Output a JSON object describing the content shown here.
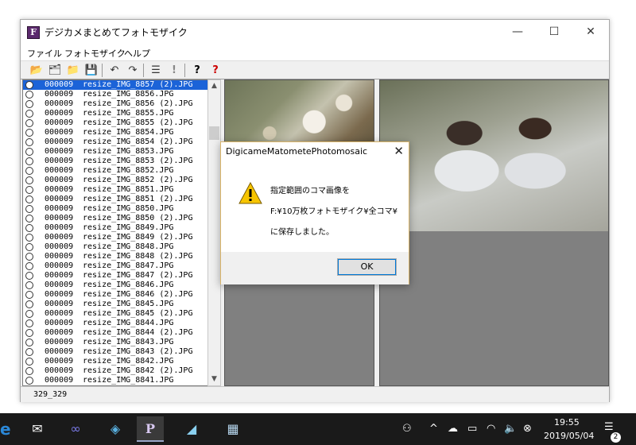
{
  "window": {
    "title": "デジカメまとめてフォトモザイク",
    "icon_letter": "F",
    "minimize": "—",
    "maximize": "☐",
    "close": "✕"
  },
  "menu": [
    "ファイル",
    "フォトモザイク",
    "ヘルプ"
  ],
  "toolbar": {
    "icons": [
      "open-folder-icon",
      "new-folder-icon",
      "folder-icon",
      "save-icon",
      "undo-icon",
      "redo-icon",
      "list-icon",
      "exclamation-icon",
      "help-icon",
      "help-red-icon"
    ],
    "glyphs": [
      "📂",
      "🗂",
      "📁",
      "💾",
      "↶",
      "↷",
      "☰",
      "!",
      "?",
      "?"
    ],
    "help_red_color": "#cc0000"
  },
  "file_list": {
    "rows": [
      {
        "num": "000009",
        "name": "resize_IMG_8857 (2).JPG"
      },
      {
        "num": "000009",
        "name": "resize_IMG_8856.JPG"
      },
      {
        "num": "000009",
        "name": "resize_IMG_8856 (2).JPG"
      },
      {
        "num": "000009",
        "name": "resize_IMG_8855.JPG"
      },
      {
        "num": "000009",
        "name": "resize_IMG_8855 (2).JPG"
      },
      {
        "num": "000009",
        "name": "resize_IMG_8854.JPG"
      },
      {
        "num": "000009",
        "name": "resize_IMG_8854 (2).JPG"
      },
      {
        "num": "000009",
        "name": "resize_IMG_8853.JPG"
      },
      {
        "num": "000009",
        "name": "resize_IMG_8853 (2).JPG"
      },
      {
        "num": "000009",
        "name": "resize_IMG_8852.JPG"
      },
      {
        "num": "000009",
        "name": "resize_IMG_8852 (2).JPG"
      },
      {
        "num": "000009",
        "name": "resize_IMG_8851.JPG"
      },
      {
        "num": "000009",
        "name": "resize_IMG_8851 (2).JPG"
      },
      {
        "num": "000009",
        "name": "resize_IMG_8850.JPG"
      },
      {
        "num": "000009",
        "name": "resize_IMG_8850 (2).JPG"
      },
      {
        "num": "000009",
        "name": "resize_IMG_8849.JPG"
      },
      {
        "num": "000009",
        "name": "resize_IMG_8849 (2).JPG"
      },
      {
        "num": "000009",
        "name": "resize_IMG_8848.JPG"
      },
      {
        "num": "000009",
        "name": "resize_IMG_8848 (2).JPG"
      },
      {
        "num": "000009",
        "name": "resize_IMG_8847.JPG"
      },
      {
        "num": "000009",
        "name": "resize_IMG_8847 (2).JPG"
      },
      {
        "num": "000009",
        "name": "resize_IMG_8846.JPG"
      },
      {
        "num": "000009",
        "name": "resize_IMG_8846 (2).JPG"
      },
      {
        "num": "000009",
        "name": "resize_IMG_8845.JPG"
      },
      {
        "num": "000009",
        "name": "resize_IMG_8845 (2).JPG"
      },
      {
        "num": "000009",
        "name": "resize_IMG_8844.JPG"
      },
      {
        "num": "000009",
        "name": "resize_IMG_8844 (2).JPG"
      },
      {
        "num": "000009",
        "name": "resize_IMG_8843.JPG"
      },
      {
        "num": "000009",
        "name": "resize_IMG_8843 (2).JPG"
      },
      {
        "num": "000009",
        "name": "resize_IMG_8842.JPG"
      },
      {
        "num": "000009",
        "name": "resize_IMG_8842 (2).JPG"
      },
      {
        "num": "000009",
        "name": "resize_IMG_8841.JPG"
      }
    ],
    "selected_index": 0,
    "selection_color": "#1b63d8",
    "scroll_up": "▲",
    "scroll_down": "▼"
  },
  "status": {
    "text": "329_329"
  },
  "dialog": {
    "title": "DigicameMatometePhotomosaic",
    "close": "✕",
    "icon": "warning-icon",
    "lines": [
      "指定範囲のコマ画像を",
      "F:¥10万枚フォトモザイク¥全コマ¥",
      "に保存しました。"
    ],
    "ok_label": "OK"
  },
  "taskbar": {
    "items": [
      {
        "name": "mail-icon",
        "glyph": "✉"
      },
      {
        "name": "infinity-app-icon",
        "glyph": "∞"
      },
      {
        "name": "diamond-app-icon",
        "glyph": "◈"
      },
      {
        "name": "photomosaic-app-icon",
        "glyph": "P"
      },
      {
        "name": "pen-app-icon",
        "glyph": "◢"
      },
      {
        "name": "image-app-icon",
        "glyph": "▦"
      }
    ],
    "tray": [
      {
        "name": "people-icon",
        "glyph": "⚇"
      },
      {
        "name": "chevron-up-icon",
        "glyph": "^"
      },
      {
        "name": "cloud-icon",
        "glyph": "☁"
      },
      {
        "name": "battery-icon",
        "glyph": "▭"
      },
      {
        "name": "wifi-icon",
        "glyph": "◠"
      },
      {
        "name": "volume-icon",
        "glyph": "🔈"
      },
      {
        "name": "blocked-icon",
        "glyph": "⊗"
      }
    ],
    "time": "19:55",
    "date": "2019/05/04",
    "notification_glyph": "☰",
    "notification_count": "2"
  }
}
